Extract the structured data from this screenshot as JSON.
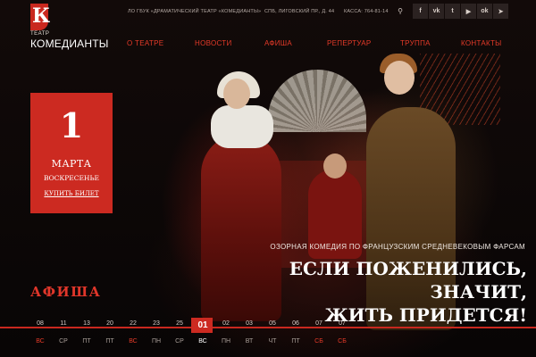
{
  "logo": {
    "mark_letter": "К",
    "small_label": "ТЕАТР",
    "name": "КОМЕДИАНТЫ"
  },
  "top_info": {
    "org": "ЛО ГБУК «ДРАМАТИЧЕСКИЙ ТЕАТР «КОМЕДИАНТЫ»",
    "address": "СПБ, ЛИГОВСКИЙ ПР., Д. 44",
    "phone": "КАССА: 764-81-14"
  },
  "icons": {
    "search": "search-icon",
    "social": [
      "facebook-icon",
      "vk-icon",
      "twitter-icon",
      "youtube-icon",
      "odnoklassniki-icon",
      "telegram-icon"
    ]
  },
  "social_glyphs": [
    "f",
    "vk",
    "t",
    "▶",
    "ok",
    "➤"
  ],
  "nav": [
    "О ТЕАТРЕ",
    "НОВОСТИ",
    "АФИША",
    "РЕПЕРТУАР",
    "ТРУППА",
    "КОНТАКТЫ"
  ],
  "date_card": {
    "day": "1",
    "month": "МАРТА",
    "weekday": "ВОСКРЕСЕНЬЕ",
    "buy_label": "КУПИТЬ БИЛЕТ"
  },
  "show": {
    "subtitle": "ОЗОРНАЯ КОМЕДИЯ ПО ФРАНЦУЗСКИМ СРЕДНЕВЕКОВЫМ ФАРСАМ",
    "title_line1": "ЕСЛИ ПОЖЕНИЛИСЬ, ЗНАЧИТ,",
    "title_line2": "ЖИТЬ ПРИДЕТСЯ!"
  },
  "afisha_label": "АФИША",
  "calendar": {
    "days": [
      {
        "num": "08",
        "wd": "ВС",
        "weekend": true
      },
      {
        "num": "11",
        "wd": "СР",
        "weekend": false
      },
      {
        "num": "13",
        "wd": "ПТ",
        "weekend": false
      },
      {
        "num": "20",
        "wd": "ПТ",
        "weekend": false
      },
      {
        "num": "22",
        "wd": "ВС",
        "weekend": true
      },
      {
        "num": "23",
        "wd": "ПН",
        "weekend": false
      },
      {
        "num": "25",
        "wd": "СР",
        "weekend": false
      },
      {
        "num": "01",
        "wd": "ВС",
        "weekend": true,
        "selected": true
      },
      {
        "num": "02",
        "wd": "ПН",
        "weekend": false
      },
      {
        "num": "03",
        "wd": "ВТ",
        "weekend": false
      },
      {
        "num": "05",
        "wd": "ЧТ",
        "weekend": false
      },
      {
        "num": "06",
        "wd": "ПТ",
        "weekend": false
      },
      {
        "num": "07",
        "wd": "СБ",
        "weekend": true
      },
      {
        "num": "07",
        "wd": "СБ",
        "weekend": true
      }
    ]
  },
  "colors": {
    "accent": "#cc2a21",
    "nav_text": "#e53a28",
    "background": "#0d0807"
  }
}
